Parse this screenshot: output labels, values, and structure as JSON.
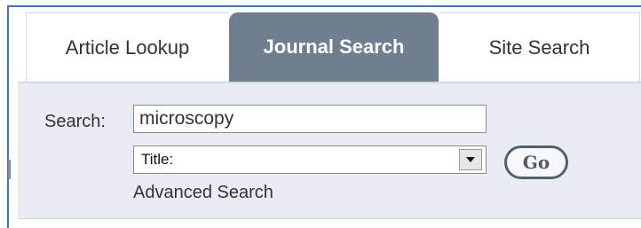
{
  "tabs": [
    {
      "label": "Article Lookup"
    },
    {
      "label": "Journal Search",
      "active": true
    },
    {
      "label": "Site Search"
    }
  ],
  "search": {
    "label": "Search:",
    "value": "microscopy"
  },
  "field_select": {
    "selected": "Title:"
  },
  "go_button": {
    "label": "Go"
  },
  "advanced_link": {
    "label": "Advanced Search"
  },
  "colors": {
    "active_tab": "#6f7f8f",
    "panel": "#e9edf3",
    "frame_border": "#3c77c4"
  }
}
